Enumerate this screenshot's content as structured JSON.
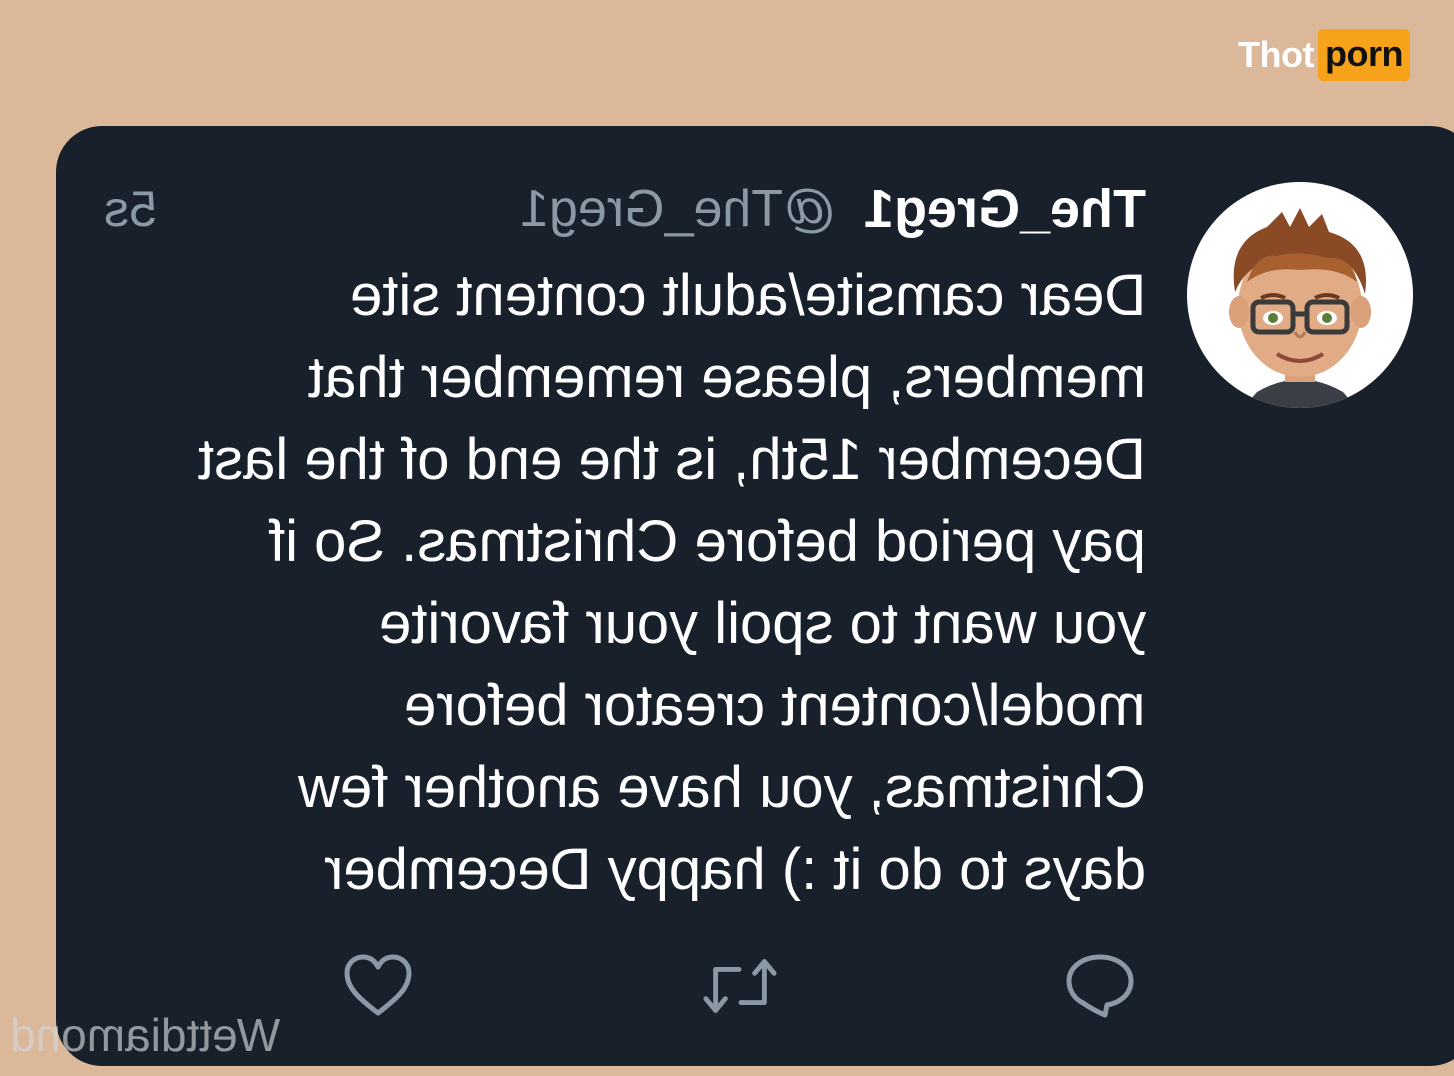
{
  "watermark": {
    "part_a": "Thot",
    "part_b": "porn",
    "accent": "#f6a21a"
  },
  "tweet": {
    "author_name": "The_Greg1",
    "handle": "@The_Greg1",
    "age": "5s",
    "lines": [
      "Dear camsite/adult content site",
      "members, please remember that",
      "December 15th, is the end of the last",
      "pay period before Christmas. So if",
      "you want to spoil your favorite",
      "model/content creator before",
      "Christmas, you have another few",
      "days to do it :) happy December"
    ],
    "mirrored": true,
    "actions": {
      "reply_icon": "reply-icon",
      "retweet_icon": "retweet-icon",
      "like_icon": "heart-icon"
    }
  },
  "credit": "Wettdiamond",
  "colors": {
    "background": "#dbb89a",
    "card": "#17202b",
    "text_primary": "#ffffff",
    "text_secondary": "#8b98a5"
  }
}
